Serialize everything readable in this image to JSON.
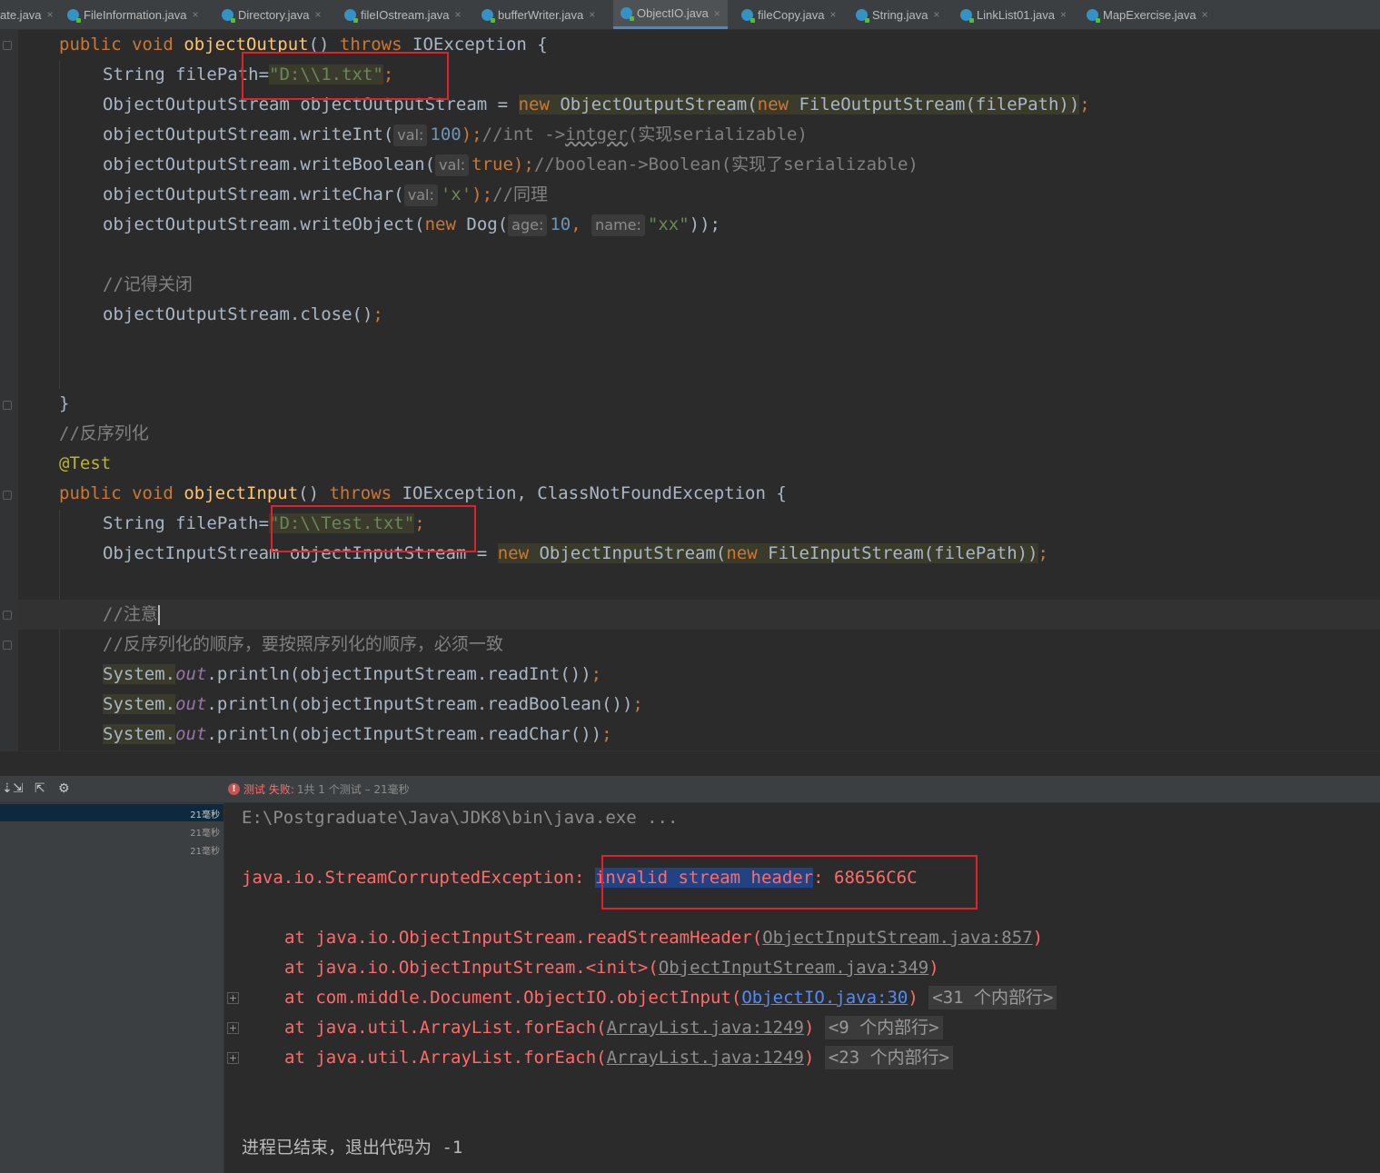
{
  "tabs": [
    {
      "label": "ate.java",
      "active": false
    },
    {
      "label": "FileInformation.java",
      "active": false
    },
    {
      "label": "Directory.java",
      "active": false
    },
    {
      "label": "fileIOstream.java",
      "active": false
    },
    {
      "label": "bufferWriter.java",
      "active": false
    },
    {
      "label": "ObjectIO.java",
      "active": true
    },
    {
      "label": "fileCopy.java",
      "active": false
    },
    {
      "label": "String.java",
      "active": false
    },
    {
      "label": "LinkList01.java",
      "active": false
    },
    {
      "label": "MapExercise.java",
      "active": false
    }
  ],
  "tab_close_glyph": "×",
  "code": {
    "l1": {
      "k1": "public",
      "k2": "void",
      "fn": "objectOutput",
      "p": "() ",
      "k3": "throws",
      "t": " IOException {"
    },
    "l2": {
      "a": "String filePath=",
      "s": "\"D:\\\\1.txt\"",
      "e": ";"
    },
    "l3": {
      "a": "ObjectOutputStream objectOutputStream = ",
      "k1": "new",
      "b": " ObjectOutputStream(",
      "k2": "new",
      "c": " FileOutputStream(filePath))",
      "e": ";"
    },
    "l4": {
      "a": "objectOutputStream.writeInt(",
      "h": "val:",
      "n": "100",
      "b": ");",
      "c": "//int ->",
      "sq": "intger",
      "d": "(实现serializable)"
    },
    "l5": {
      "a": "objectOutputStream.writeBoolean(",
      "h": "val:",
      "k": "true",
      "b": ");",
      "c": "//boolean->Boolean(实现了serializable)"
    },
    "l6": {
      "a": "objectOutputStream.writeChar(",
      "h": "val:",
      "s": "'x'",
      "b": ");",
      "c": "//同理"
    },
    "l7": {
      "a": "objectOutputStream.writeObject(",
      "k": "new",
      "b": " Dog(",
      "h1": "age:",
      "n": "10",
      "sep": ", ",
      "h2": "name:",
      "s": "\"xx\"",
      "e": "));"
    },
    "l8": {
      "c": "//记得关闭"
    },
    "l9": {
      "a": "objectOutputStream.close()",
      "e": ";"
    },
    "l10": {
      "a": "}"
    },
    "l11": {
      "c": "//反序列化"
    },
    "l12": {
      "ann": "@Test"
    },
    "l13": {
      "k1": "public",
      "k2": "void",
      "fn": "objectInput",
      "p": "() ",
      "k3": "throws",
      "t": " IOException, ClassNotFoundException {"
    },
    "l14": {
      "a": "String filePath=",
      "s": "\"D:\\\\Test.txt\"",
      "e": ";"
    },
    "l15": {
      "a": "ObjectInputStream objectInputStream = ",
      "k1": "new",
      "b": " ObjectInputStream(",
      "k2": "new",
      "c": " FileInputStream(filePath))",
      "e": ";"
    },
    "l16": {
      "c": "//注意"
    },
    "l17": {
      "c": "//反序列化的顺序，要按照序列化的顺序，必须一致"
    },
    "l18": {
      "a": "System.",
      "f": "out",
      "b": ".println(objectInputStream.readInt())",
      "e": ";"
    },
    "l19": {
      "a": "System.",
      "f": "out",
      "b": ".println(objectInputStream.readBoolean())",
      "e": ";"
    },
    "l20": {
      "a": "System.",
      "f": "out",
      "b": ".println(objectInputStream.readChar())",
      "e": ";"
    }
  },
  "run": {
    "status_prefix": "测试 失败:",
    "status_detail": "1共 1 个测试 – 21毫秒",
    "times": [
      "21毫秒",
      "21毫秒",
      "21毫秒"
    ],
    "icons": [
      "expand-icon",
      "collapse-icon",
      "export-icon",
      "settings-icon"
    ]
  },
  "console": {
    "cmd": "E:\\Postgraduate\\Java\\JDK8\\bin\\java.exe ...",
    "exc_class": "java.io.StreamCorruptedException:",
    "exc_sel": "invalid stream header",
    "exc_rest": ": 68656C6C",
    "frames": [
      {
        "at": "at java.io.ObjectInputStream.readStreamHeader(",
        "loc": "ObjectInputStream.java:857",
        "close": ")",
        "fold": ""
      },
      {
        "at": "at java.io.ObjectInputStream.<init>(",
        "loc": "ObjectInputStream.java:349",
        "close": ")",
        "fold": ""
      },
      {
        "at": "at com.middle.Document.ObjectIO.objectInput(",
        "loc": "ObjectIO.java:30",
        "close": ")",
        "fold": "<31 个内部行>"
      },
      {
        "at": "at java.util.ArrayList.forEach(",
        "loc": "ArrayList.java:1249",
        "close": ")",
        "fold": "<9 个内部行>"
      },
      {
        "at": "at java.util.ArrayList.forEach(",
        "loc": "ArrayList.java:1249",
        "close": ")",
        "fold": "<23 个内部行>"
      }
    ],
    "exit": "进程已结束，退出代码为 -1"
  },
  "colors": {
    "accent": "#4a88c7",
    "annotation_red": "#e0202a",
    "error_text": "#ff6b68"
  }
}
